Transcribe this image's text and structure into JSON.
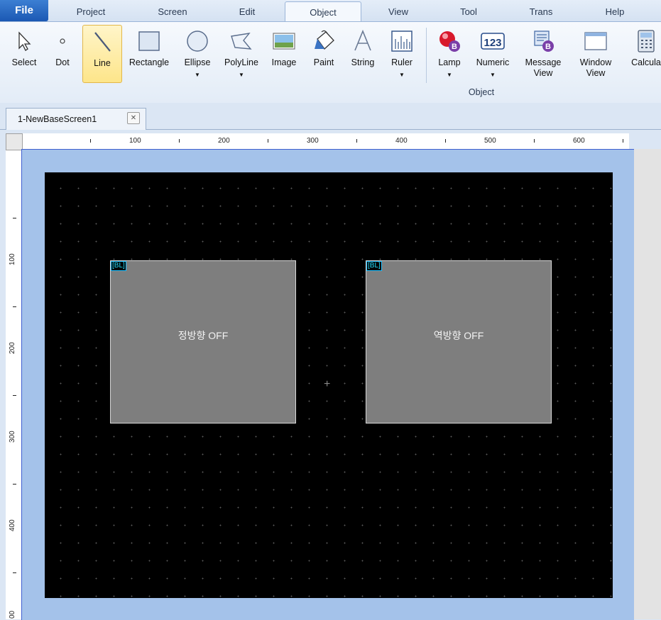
{
  "menu": {
    "file": "File",
    "tabs": [
      "Project",
      "Screen",
      "Edit",
      "Object",
      "View",
      "Tool",
      "Trans",
      "Help"
    ],
    "active_tab": "Object"
  },
  "ribbon": {
    "buttons": [
      {
        "label": "Select",
        "icon": "cursor-icon"
      },
      {
        "label": "Dot",
        "icon": "dot-icon"
      },
      {
        "label": "Line",
        "icon": "line-icon",
        "selected": true
      },
      {
        "label": "Rectangle",
        "icon": "rectangle-icon"
      },
      {
        "label": "Ellipse",
        "icon": "ellipse-icon",
        "dropdown": true
      },
      {
        "label": "PolyLine",
        "icon": "polyline-icon",
        "dropdown": true
      },
      {
        "label": "Image",
        "icon": "image-icon"
      },
      {
        "label": "Paint",
        "icon": "paint-bucket-icon"
      },
      {
        "label": "String",
        "icon": "string-icon"
      },
      {
        "label": "Ruler",
        "icon": "ruler-icon",
        "dropdown": true
      },
      {
        "label": "Lamp",
        "icon": "lamp-icon",
        "dropdown": true
      },
      {
        "label": "Numeric",
        "icon": "numeric-icon",
        "dropdown": true,
        "glyph": "123"
      },
      {
        "label": "Message\nView",
        "icon": "message-view-icon"
      },
      {
        "label": "Window\nView",
        "icon": "window-view-icon"
      },
      {
        "label": "Calcula",
        "icon": "calculator-icon"
      }
    ],
    "group_label": "Object"
  },
  "document": {
    "tab_label": "1-NewBaseScreen1"
  },
  "rulers": {
    "horizontal_labels": [
      "100",
      "200",
      "300",
      "400",
      "500",
      "600"
    ],
    "vertical_labels": [
      "100",
      "200",
      "300",
      "400",
      "00"
    ]
  },
  "canvas": {
    "lamps": [
      {
        "tag": "[BL]",
        "text": "정방향 OFF"
      },
      {
        "tag": "[BL]",
        "text": "역방향 OFF"
      }
    ],
    "crosshair": "+"
  },
  "colors": {
    "screen_bg": "#000000",
    "frame": "#a4c2ea",
    "lamp_fill": "#7e7e7e",
    "tag_color": "#20e0ff",
    "selected_button": "#fde58a"
  }
}
